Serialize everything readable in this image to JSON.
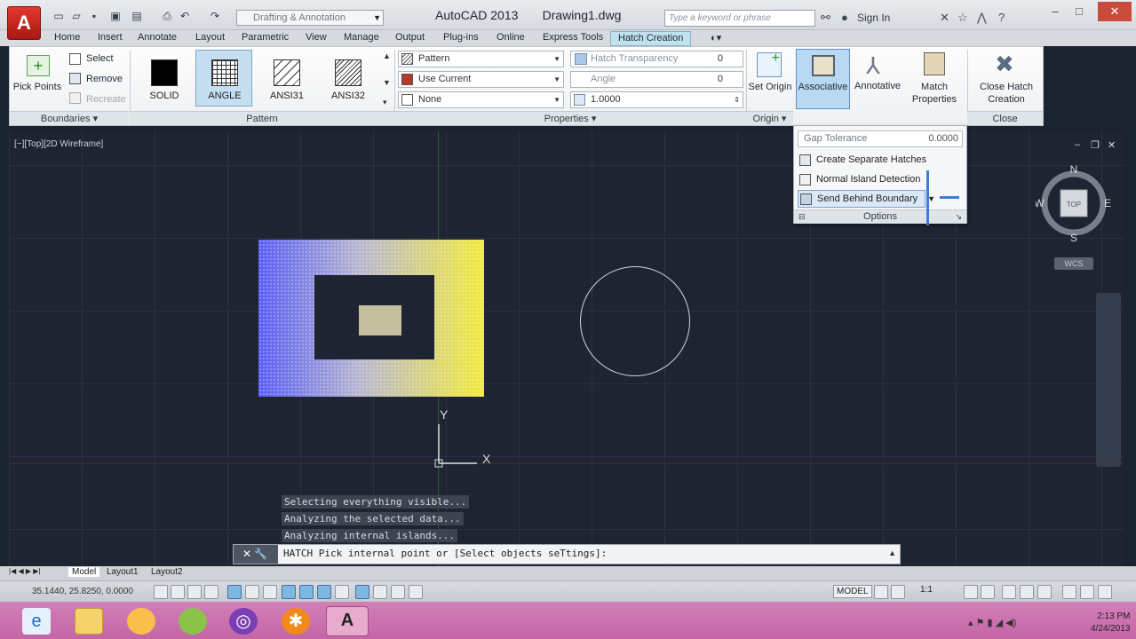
{
  "titlebar": {
    "title": "AutoCAD 2013",
    "document": "Drawing1.dwg",
    "workspace": "Drafting & Annotation",
    "search_placeholder": "Type a keyword or phrase",
    "signin": "Sign In"
  },
  "ribbon_tabs": [
    "Home",
    "Insert",
    "Annotate",
    "Layout",
    "Parametric",
    "View",
    "Manage",
    "Output",
    "Plug-ins",
    "Online",
    "Express Tools",
    "Hatch Creation"
  ],
  "active_tab": "Hatch Creation",
  "boundaries": {
    "pick_points": "Pick Points",
    "select": "Select",
    "remove": "Remove",
    "recreate": "Recreate",
    "panel_title": "Boundaries ▾"
  },
  "pattern": {
    "swatches": [
      "SOLID",
      "ANGLE",
      "ANSI31",
      "ANSI32"
    ],
    "selected": "ANGLE",
    "panel_title": "Pattern"
  },
  "properties": {
    "type": "Pattern",
    "color": "Use Current",
    "background": "None",
    "transparency_label": "Hatch Transparency",
    "transparency_value": "0",
    "angle_label": "Angle",
    "angle_value": "0",
    "scale_value": "1.0000",
    "panel_title": "Properties ▾"
  },
  "origin": {
    "set_origin": "Set Origin",
    "panel_title": "Origin ▾"
  },
  "options": {
    "associative": "Associative",
    "annotative": "Annotative",
    "match_properties": "Match Properties",
    "gap_tolerance_label": "Gap Tolerance",
    "gap_tolerance_value": "0.0000",
    "create_separate": "Create Separate Hatches",
    "island_detection": "Normal Island Detection",
    "draw_order": "Send Behind Boundary",
    "panel_title": "Options"
  },
  "close": {
    "label": "Close Hatch Creation",
    "panel_title": "Close"
  },
  "viewport_label": "[−][Top][2D Wireframe]",
  "viewcube": {
    "n": "N",
    "s": "S",
    "e": "E",
    "w": "W",
    "top": "TOP",
    "wcs": "WCS"
  },
  "ucs": {
    "x": "X",
    "y": "Y"
  },
  "command_history": [
    "Selecting everything visible...",
    "Analyzing the selected data...",
    "Analyzing internal islands..."
  ],
  "command_line": {
    "prompt": "HATCH Pick internal point or [Select objects seTtings]:"
  },
  "layout_tabs": [
    "Model",
    "Layout1",
    "Layout2"
  ],
  "status": {
    "coords": "35.1440, 25.8250, 0.0000",
    "model": "MODEL",
    "scale": "1:1"
  },
  "clock": {
    "time": "2:13 PM",
    "date": "4/24/2013"
  }
}
